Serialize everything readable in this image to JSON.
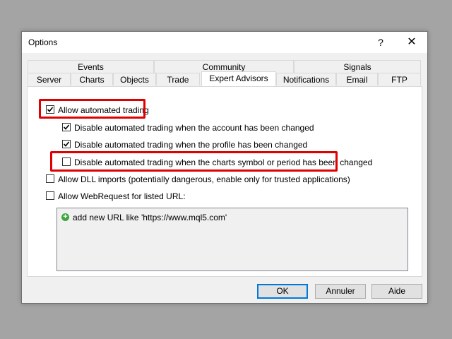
{
  "window": {
    "title": "Options",
    "help_glyph": "?",
    "close_glyph": "✕"
  },
  "tabs": {
    "row1": [
      "Events",
      "Community",
      "Signals"
    ],
    "row2": [
      "Server",
      "Charts",
      "Objects",
      "Trade",
      "Expert Advisors",
      "Notifications",
      "Email",
      "FTP"
    ],
    "active": "Expert Advisors"
  },
  "options": [
    {
      "label": "Allow automated trading",
      "checked": true,
      "highlighted": true
    },
    {
      "label": "Disable automated trading when the account has been changed",
      "checked": true,
      "highlighted": false
    },
    {
      "label": "Disable automated trading when the profile has been changed",
      "checked": true,
      "highlighted": false
    },
    {
      "label": "Disable automated trading when the charts symbol or period has been changed",
      "checked": false,
      "highlighted": true
    },
    {
      "label": "Allow DLL imports (potentially dangerous, enable only for trusted applications)",
      "checked": false,
      "highlighted": false
    },
    {
      "label": "Allow WebRequest for listed URL:",
      "checked": false,
      "highlighted": false
    }
  ],
  "url_list": {
    "items": [
      "add new URL like 'https://www.mql5.com'"
    ]
  },
  "buttons": {
    "ok": "OK",
    "cancel": "Annuler",
    "help": "Aide"
  },
  "colors": {
    "highlight": "#e00000",
    "default_button_border": "#0078d7",
    "add_icon": "#3da53b"
  }
}
